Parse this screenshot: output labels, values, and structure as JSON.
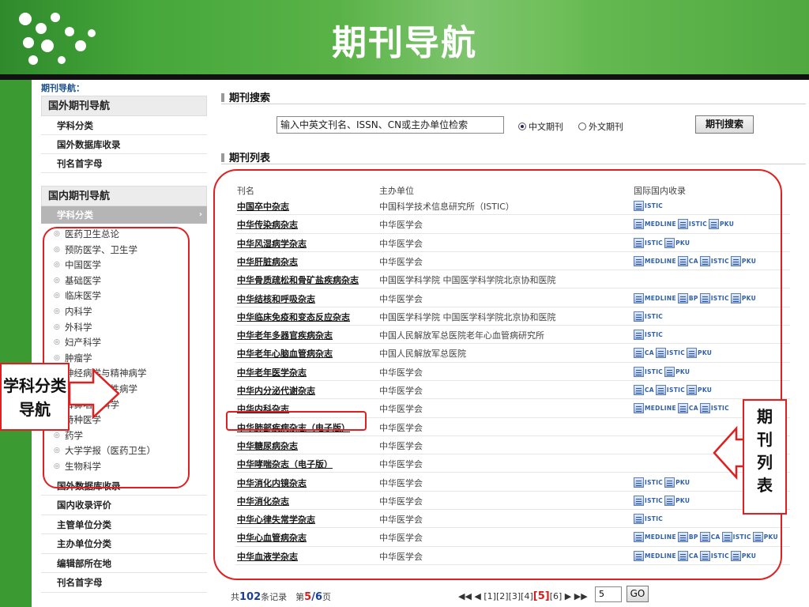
{
  "slide": {
    "title": "期刊导航",
    "colors": {
      "green": "#3b9a32",
      "annotation_red": "#e02020",
      "link_blue": "#1a3f9b"
    }
  },
  "breadcrumb": "期刊导航：",
  "sidebar": {
    "foreign_heading": "国外期刊导航",
    "foreign_items": [
      "学科分类",
      "国外数据库收录",
      "刊名首字母"
    ],
    "domestic_heading": "国内期刊导航",
    "active_item": "学科分类",
    "subjects": [
      "医药卫生总论",
      "预防医学、卫生学",
      "中国医学",
      "基础医学",
      "临床医学",
      "内科学",
      "外科学",
      "妇产科学",
      "肿瘤学",
      "神经病学与精神病学",
      "皮肤病学与性病学",
      "耳鼻咽喉科学",
      "特种医学",
      "药学",
      "大学学报（医药卫生）",
      "生物科学"
    ],
    "bottom_items": [
      "国外数据库收录",
      "国内收录评价",
      "主管单位分类",
      "主办单位分类",
      "编辑部所在地",
      "刊名首字母"
    ]
  },
  "search": {
    "section_title": "期刊搜索",
    "input_value": "输入中英文刊名、ISSN、CN或主办单位检索",
    "radio_cn": "中文期刊",
    "radio_foreign": "外文期刊",
    "selected": "中文期刊",
    "button_label": "期刊搜索"
  },
  "list": {
    "section_title": "期刊列表",
    "columns": [
      "刊名",
      "主办单位",
      "国际国内收录"
    ],
    "rows": [
      {
        "name": "中国卒中杂志",
        "org": "中国科学技术信息研究所（ISTIC）",
        "index": [
          "ISTIC"
        ]
      },
      {
        "name": "中华传染病杂志",
        "org": "中华医学会",
        "index": [
          "MEDLINE",
          "ISTIC",
          "PKU"
        ]
      },
      {
        "name": "中华风湿病学杂志",
        "org": "中华医学会",
        "index": [
          "ISTIC",
          "PKU"
        ]
      },
      {
        "name": "中华肝脏病杂志",
        "org": "中华医学会",
        "index": [
          "MEDLINE",
          "CA",
          "ISTIC",
          "PKU"
        ]
      },
      {
        "name": "中华骨质疏松和骨矿盐疾病杂志",
        "org": "中国医学科学院 中国医学科学院北京协和医院",
        "index": []
      },
      {
        "name": "中华结核和呼吸杂志",
        "org": "中华医学会",
        "index": [
          "MEDLINE",
          "BP",
          "ISTIC",
          "PKU"
        ]
      },
      {
        "name": "中华临床免疫和变态反应杂志",
        "org": "中国医学科学院 中国医学科学院北京协和医院",
        "index": [
          "ISTIC"
        ]
      },
      {
        "name": "中华老年多器官疾病杂志",
        "org": "中国人民解放军总医院老年心血管病研究所",
        "index": [
          "ISTIC"
        ]
      },
      {
        "name": "中华老年心脑血管病杂志",
        "org": "中国人民解放军总医院",
        "index": [
          "CA",
          "ISTIC",
          "PKU"
        ]
      },
      {
        "name": "中华老年医学杂志",
        "org": "中华医学会",
        "index": [
          "ISTIC",
          "PKU"
        ]
      },
      {
        "name": "中华内分泌代谢杂志",
        "org": "中华医学会",
        "index": [
          "CA",
          "ISTIC",
          "PKU"
        ]
      },
      {
        "name": "中华内科杂志",
        "org": "中华医学会",
        "index": [
          "MEDLINE",
          "CA",
          "ISTIC"
        ]
      },
      {
        "name": "中华肺部疾病杂志（电子版）",
        "org": "中华医学会",
        "index": []
      },
      {
        "name": "中华糖尿病杂志",
        "org": "中华医学会",
        "index": []
      },
      {
        "name": "中华哮喘杂志（电子版）",
        "org": "中华医学会",
        "index": []
      },
      {
        "name": "中华消化内镜杂志",
        "org": "中华医学会",
        "index": [
          "ISTIC",
          "PKU"
        ]
      },
      {
        "name": "中华消化杂志",
        "org": "中华医学会",
        "index": [
          "ISTIC",
          "PKU"
        ]
      },
      {
        "name": "中华心律失常学杂志",
        "org": "中华医学会",
        "index": [
          "ISTIC"
        ]
      },
      {
        "name": "中华心血管病杂志",
        "org": "中华医学会",
        "index": [
          "MEDLINE",
          "BP",
          "CA",
          "ISTIC",
          "PKU"
        ]
      },
      {
        "name": "中华血液学杂志",
        "org": "中华医学会",
        "index": [
          "MEDLINE",
          "CA",
          "ISTIC",
          "PKU"
        ]
      }
    ]
  },
  "footer": {
    "prefix": "共",
    "total": "102",
    "records_text": "条记录　第",
    "current_page": "5",
    "slash": "/",
    "total_pages": "6",
    "page_suffix": "页",
    "pager_prev": "◀◀ ◀",
    "pages": [
      "[1]",
      "[2]",
      "[3]",
      "[4]",
      "[5]",
      "[6]"
    ],
    "pager_next": "▶ ▶▶",
    "page_input": "5",
    "go_label": "GO"
  },
  "annotations": {
    "left_callout": "学科分类导航",
    "right_callout": "期刊列表"
  }
}
